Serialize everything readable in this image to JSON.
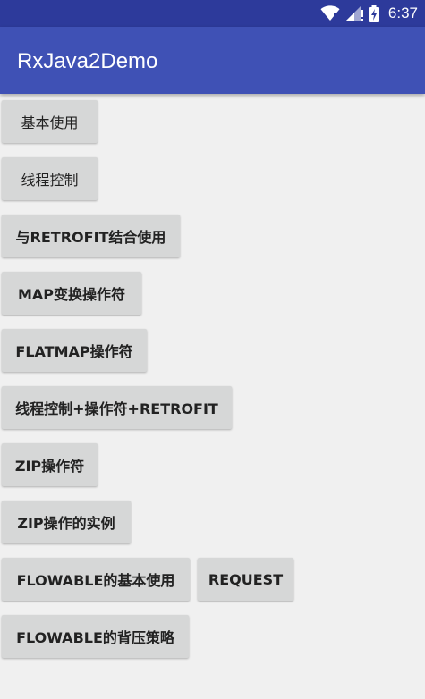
{
  "status_bar": {
    "time": "6:37",
    "icons": [
      "wifi-icon",
      "signal-icon",
      "battery-charging-icon"
    ]
  },
  "app_bar": {
    "title": "RxJava2Demo"
  },
  "buttons": {
    "basic_usage": "基本使用",
    "thread_control": "线程控制",
    "with_retrofit": "与RETROFIT结合使用",
    "map_operator": "MAP变换操作符",
    "flatmap_operator": "FLATMAP操作符",
    "thread_operator_retrofit": "线程控制+操作符+RETROFIT",
    "zip_operator": "ZIP操作符",
    "zip_example": "ZIP操作的实例",
    "flowable_basic": "FLOWABLE的基本使用",
    "request": "REQUEST",
    "flowable_backpressure": "FLOWABLE的背压策略"
  },
  "colors": {
    "status_bar": "#2d3a9b",
    "app_bar": "#3f51b5",
    "background": "#f0f0f0",
    "button": "#d6d7d7"
  }
}
